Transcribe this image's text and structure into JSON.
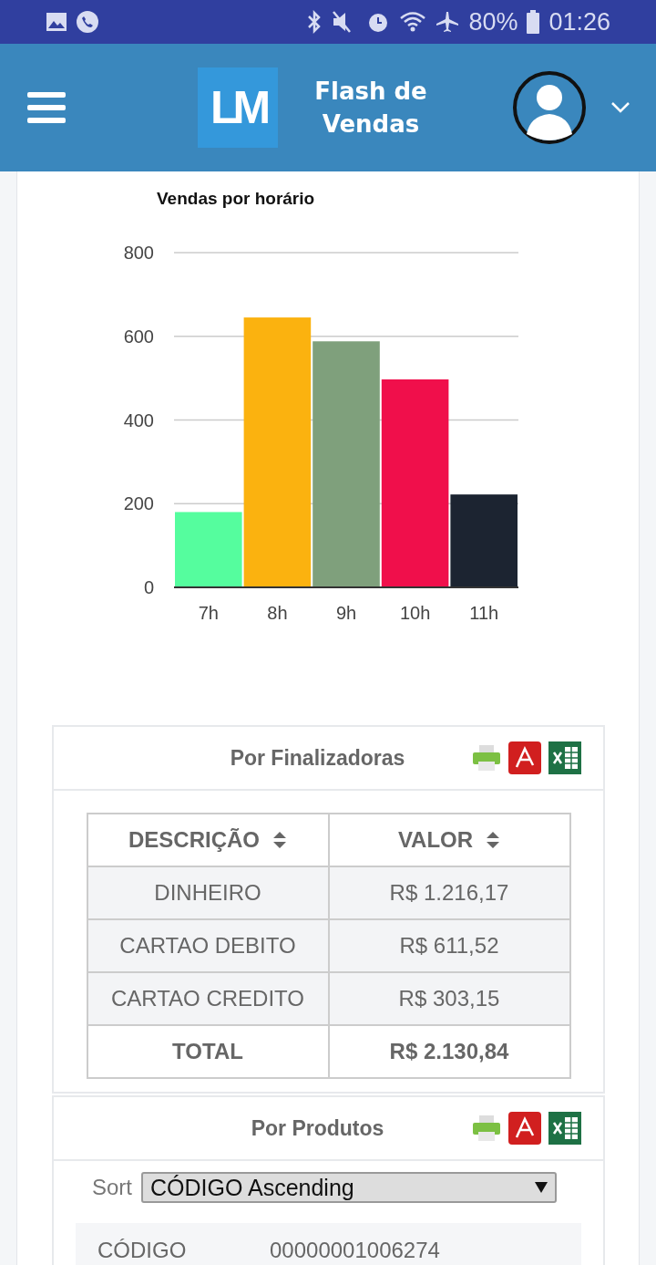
{
  "status_bar": {
    "battery": "80%",
    "time": "01:26"
  },
  "header": {
    "logo": "LM",
    "title": "Flash de Vendas"
  },
  "chart": {
    "chart_data": {
      "type": "bar",
      "title": "Vendas por horário",
      "categories": [
        "7h",
        "8h",
        "9h",
        "10h",
        "11h"
      ],
      "values": [
        180,
        645,
        588,
        497,
        222
      ],
      "grid": true,
      "colors": [
        "#55fd9e",
        "#fbb20f",
        "#7fa07c",
        "#f00f4b",
        "#1c2431"
      ],
      "ylim": [
        0,
        800
      ],
      "yticks": [
        0,
        200,
        400,
        600,
        800
      ]
    }
  },
  "finalizadoras": {
    "title": "Por Finalizadoras",
    "columns": [
      "DESCRIÇÃO",
      "VALOR"
    ],
    "rows": [
      {
        "descricao": "DINHEIRO",
        "valor": "R$ 1.216,17"
      },
      {
        "descricao": "CARTAO DEBITO",
        "valor": "R$ 611,52"
      },
      {
        "descricao": "CARTAO CREDITO",
        "valor": "R$ 303,15"
      }
    ],
    "total": {
      "label": "TOTAL",
      "value": "R$ 2.130,84"
    }
  },
  "produtos": {
    "title": "Por Produtos",
    "sort_label": "Sort",
    "sort_value": "CÓDIGO Ascending",
    "fields": [
      {
        "label": "CÓDIGO",
        "value": "00000001006274"
      }
    ]
  }
}
